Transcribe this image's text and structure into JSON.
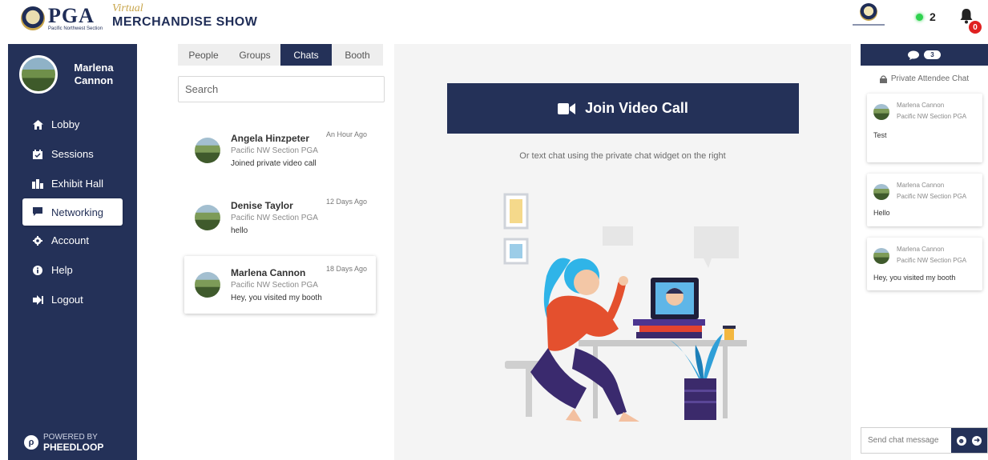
{
  "header": {
    "logo_text": "PGA",
    "logo_subtitle": "Pacific Northwest Section",
    "show_virtual": "Virtual",
    "show_title": "MERCHANDISE SHOW",
    "online_count": "2",
    "notification_count": "0"
  },
  "sidebar": {
    "user_name": "Marlena Cannon",
    "items": [
      {
        "label": "Lobby",
        "icon": "home-icon",
        "active": false
      },
      {
        "label": "Sessions",
        "icon": "calendar-icon",
        "active": false
      },
      {
        "label": "Exhibit Hall",
        "icon": "building-icon",
        "active": false
      },
      {
        "label": "Networking",
        "icon": "chat-bubble-icon",
        "active": true
      },
      {
        "label": "Account",
        "icon": "gear-icon",
        "active": false
      },
      {
        "label": "Help",
        "icon": "info-icon",
        "active": false
      },
      {
        "label": "Logout",
        "icon": "logout-icon",
        "active": false
      }
    ],
    "powered_by": "POWERED BY",
    "powered_brand": "PHEEDLOOP"
  },
  "list_panel": {
    "tabs": [
      {
        "label": "People",
        "active": false
      },
      {
        "label": "Groups",
        "active": false
      },
      {
        "label": "Chats",
        "active": true
      },
      {
        "label": "Booth",
        "active": false
      }
    ],
    "search_placeholder": "Search",
    "chats": [
      {
        "name": "Angela Hinzpeter",
        "org": "Pacific NW Section PGA",
        "message": "Joined private video call",
        "time": "An Hour Ago"
      },
      {
        "name": "Denise Taylor",
        "org": "Pacific NW Section PGA",
        "message": "hello",
        "time": "12 Days Ago"
      },
      {
        "name": "Marlena Cannon",
        "org": "Pacific NW Section PGA",
        "message": "Hey, you visited my booth",
        "time": "18 Days Ago"
      }
    ]
  },
  "center": {
    "join_label": "Join Video Call",
    "helper_text": "Or text chat using the private chat widget on the right"
  },
  "right_panel": {
    "message_count": "3",
    "title": "Private Attendee Chat",
    "messages": [
      {
        "name": "Marlena Cannon",
        "org": "Pacific NW Section PGA",
        "text": "Test"
      },
      {
        "name": "Marlena Cannon",
        "org": "Pacific NW Section PGA",
        "text": "Hello"
      },
      {
        "name": "Marlena Cannon",
        "org": "Pacific NW Section PGA",
        "text": "Hey, you visited my booth"
      }
    ],
    "send_placeholder": "Send chat message"
  },
  "colors": {
    "navy": "#243158",
    "gold": "#c8a54a",
    "online_green": "#2fd24f",
    "badge_red": "#e02020"
  }
}
